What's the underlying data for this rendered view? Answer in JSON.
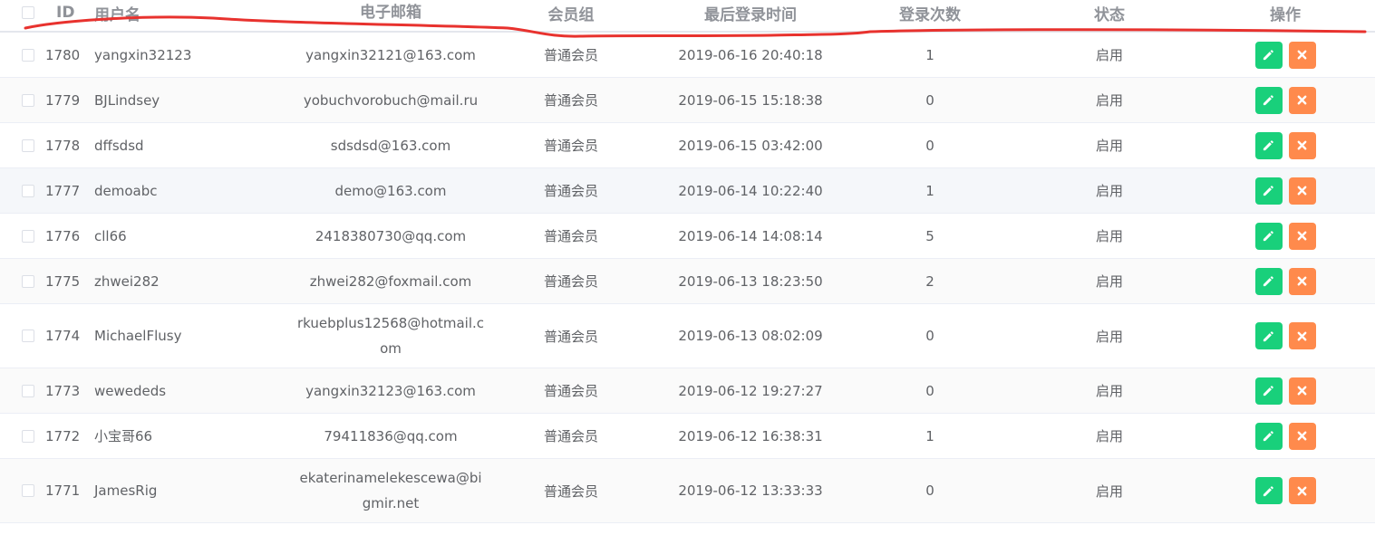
{
  "table": {
    "headers": {
      "id": "ID",
      "username": "用户名",
      "email": "电子邮箱",
      "group": "会员组",
      "last_login": "最后登录时间",
      "login_count": "登录次数",
      "status": "状态",
      "actions": "操作"
    },
    "rows": [
      {
        "id": "1780",
        "username": "yangxin32123",
        "email_lines": [
          "yangxin32121@163.com"
        ],
        "group": "普通会员",
        "last_login": "2019-06-16 20:40:18",
        "login_count": "1",
        "status": "启用"
      },
      {
        "id": "1779",
        "username": "BJLindsey",
        "email_lines": [
          "yobuchvorobuch@mail.ru"
        ],
        "group": "普通会员",
        "last_login": "2019-06-15 15:18:38",
        "login_count": "0",
        "status": "启用"
      },
      {
        "id": "1778",
        "username": "dffsdsd",
        "email_lines": [
          "sdsdsd@163.com"
        ],
        "group": "普通会员",
        "last_login": "2019-06-15 03:42:00",
        "login_count": "0",
        "status": "启用"
      },
      {
        "id": "1777",
        "username": "demoabc",
        "email_lines": [
          "demo@163.com"
        ],
        "group": "普通会员",
        "last_login": "2019-06-14 10:22:40",
        "login_count": "1",
        "status": "启用"
      },
      {
        "id": "1776",
        "username": "cll66",
        "email_lines": [
          "2418380730@qq.com"
        ],
        "group": "普通会员",
        "last_login": "2019-06-14 14:08:14",
        "login_count": "5",
        "status": "启用"
      },
      {
        "id": "1775",
        "username": "zhwei282",
        "email_lines": [
          "zhwei282@foxmail.com"
        ],
        "group": "普通会员",
        "last_login": "2019-06-13 18:23:50",
        "login_count": "2",
        "status": "启用"
      },
      {
        "id": "1774",
        "username": "MichaelFlusy",
        "email_lines": [
          "rkuebplus12568@hotmail.c",
          "om"
        ],
        "group": "普通会员",
        "last_login": "2019-06-13 08:02:09",
        "login_count": "0",
        "status": "启用"
      },
      {
        "id": "1773",
        "username": "wewededs",
        "email_lines": [
          "yangxin32123@163.com"
        ],
        "group": "普通会员",
        "last_login": "2019-06-12 19:27:27",
        "login_count": "0",
        "status": "启用"
      },
      {
        "id": "1772",
        "username": "小宝哥66",
        "email_lines": [
          "79411836@qq.com"
        ],
        "group": "普通会员",
        "last_login": "2019-06-12 16:38:31",
        "login_count": "1",
        "status": "启用"
      },
      {
        "id": "1771",
        "username": "JamesRig",
        "email_lines": [
          "ekaterinamelekescewa@bi",
          "gmir.net"
        ],
        "group": "普通会员",
        "last_login": "2019-06-12 13:33:33",
        "login_count": "0",
        "status": "启用"
      }
    ],
    "row_actions": {
      "edit_icon": "pencil-icon",
      "delete_icon": "close-icon"
    }
  },
  "colors": {
    "edit_button": "#19d07b",
    "delete_button": "#ff8a4c",
    "annotation_stroke": "#e8322e",
    "header_text": "#909399",
    "cell_text": "#606266"
  }
}
